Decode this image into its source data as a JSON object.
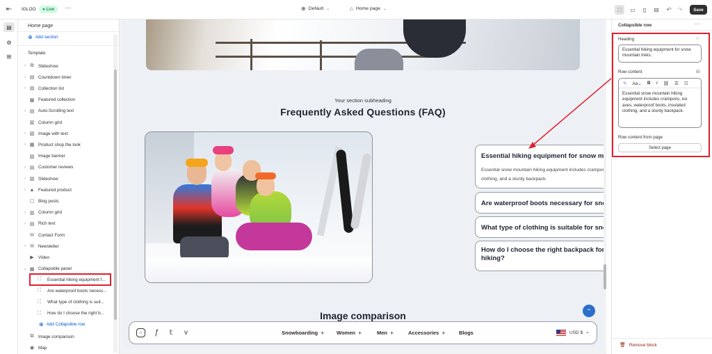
{
  "topbar": {
    "store_name": "IGLOO",
    "live_badge": "Live",
    "theme_select": "Default",
    "page_select": "Home page",
    "save_label": "Save"
  },
  "sidebar": {
    "page_title": "Home page",
    "add_section": "Add section",
    "template_label": "Template",
    "items": [
      {
        "label": "Slideshow"
      },
      {
        "label": "Countdown timer"
      },
      {
        "label": "Collection list"
      },
      {
        "label": "Featured collection"
      },
      {
        "label": "Auto-Scrolling text"
      },
      {
        "label": "Column grid"
      },
      {
        "label": "Image with text"
      },
      {
        "label": "Product shop the look"
      },
      {
        "label": "Image banner"
      },
      {
        "label": "Customer reviews"
      },
      {
        "label": "Slideshow"
      },
      {
        "label": "Featured product"
      },
      {
        "label": "Blog posts"
      },
      {
        "label": "Column grid"
      },
      {
        "label": "Rich text"
      },
      {
        "label": "Contact Form"
      },
      {
        "label": "Newsletter"
      },
      {
        "label": "Video"
      },
      {
        "label": "Collapsible panel"
      }
    ],
    "sub_items": [
      {
        "label": "Essential hiking equipment f..."
      },
      {
        "label": "Are waterproof boots necess..."
      },
      {
        "label": "What type of clothing is suit..."
      },
      {
        "label": "How do I choose the right b..."
      }
    ],
    "add_row": "Add Collapsible row",
    "after_items": [
      {
        "label": "Image comparison"
      },
      {
        "label": "Map"
      }
    ]
  },
  "preview": {
    "subheading": "Your section subheading",
    "heading": "Frequently Asked Questions (FAQ)",
    "faq": [
      {
        "q": "Essential hiking equipment for snow mountain treks.",
        "a": "Essential snow mountain hiking equipment includes crampons, ice axes, waterproof boots, insulated clothing, and a sturdy backpack.",
        "toggle": "−"
      },
      {
        "q": "Are waterproof boots necessary for snow mountain hiking?",
        "toggle": "+"
      },
      {
        "q": "What type of clothing is suitable for snow mountain hiking?",
        "toggle": "+"
      },
      {
        "q": "How do I choose the right backpack for snow mountain hiking?",
        "toggle": "+"
      }
    ],
    "next_heading": "Image comparison",
    "nav": {
      "links": [
        {
          "label": "Snowboarding",
          "plus": "+"
        },
        {
          "label": "Women",
          "plus": "+"
        },
        {
          "label": "Men",
          "plus": "+"
        },
        {
          "label": "Accessories",
          "plus": "+"
        },
        {
          "label": "Blogs"
        }
      ],
      "currency": "USD $"
    }
  },
  "panel": {
    "title": "Collapsible row",
    "heading_label": "Heading",
    "heading_value": "Essential hiking equipment for snow mountain treks.",
    "row_content_label": "Row content",
    "row_content_value": "Essential snow mountain hiking equipment includes crampons, ice axes, waterproof boots, insulated clothing, and a sturdy backpack.",
    "from_page_label": "Row content from page",
    "select_page": "Select page",
    "remove_block": "Remove block"
  },
  "colors": {
    "accent": "#e11d2e",
    "live": "#29845a",
    "scroll_button": "#2c6ecb"
  }
}
